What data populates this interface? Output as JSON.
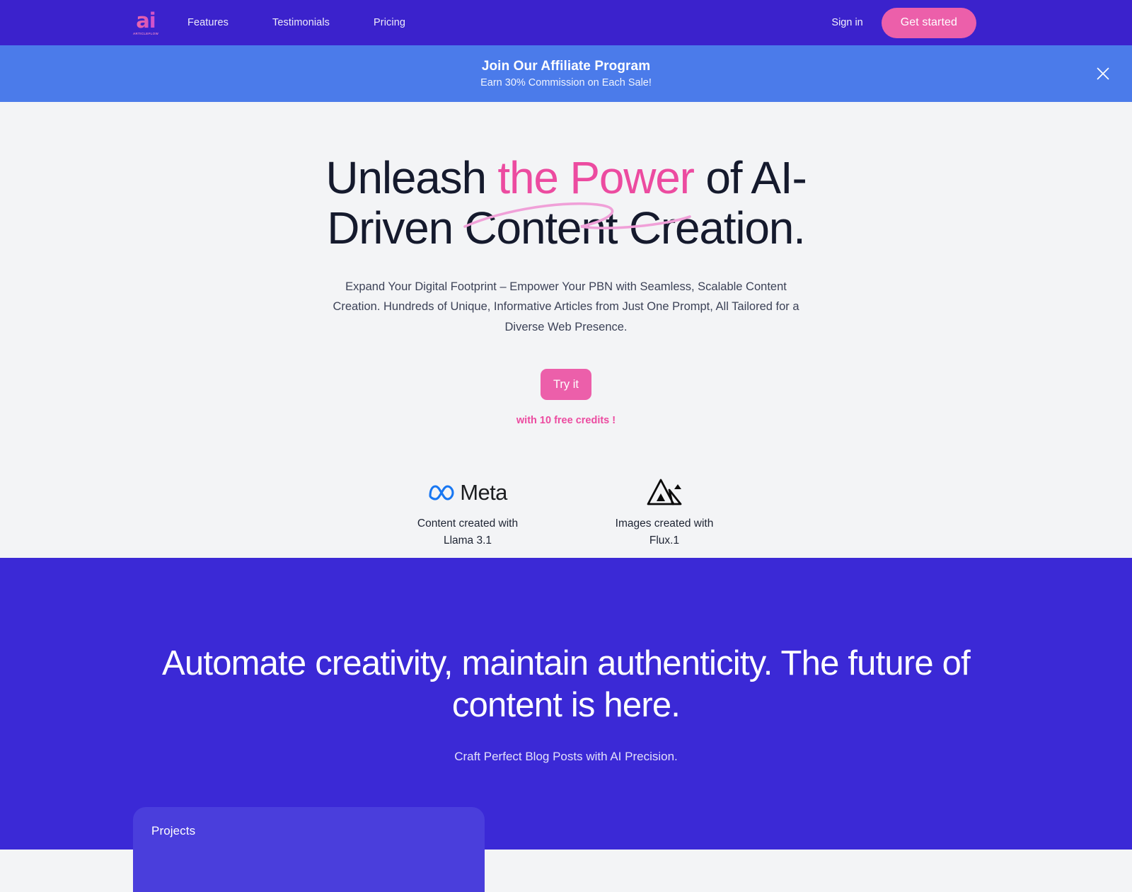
{
  "header": {
    "logo": {
      "mark": "ai",
      "subtext": "ARTICLEFLOW"
    },
    "nav_items": [
      {
        "label": "Features"
      },
      {
        "label": "Testimonials"
      },
      {
        "label": "Pricing"
      }
    ],
    "signin_label": "Sign in",
    "get_started_label": "Get started"
  },
  "banner": {
    "title": "Join Our Affiliate Program",
    "subtitle": "Earn 30% Commission on Each Sale!",
    "close_icon": "close-icon"
  },
  "hero": {
    "heading_part1": "Unleash ",
    "heading_highlight": "the Power",
    "heading_part2": " of AI-Driven Content Creation.",
    "subtitle": "Expand Your Digital Footprint – Empower Your PBN with Seamless, Scalable Content Creation. Hundreds of Unique, Informative Articles from Just One Prompt, All Tailored for a Diverse Web Presence.",
    "cta_label": "Try it",
    "credits_note": "with 10 free credits !",
    "partners": [
      {
        "logo_icon": "meta-infinity-icon",
        "name": "Meta",
        "caption": "Content created with Llama 3.1"
      },
      {
        "logo_icon": "flux-triangle-icon",
        "name": "",
        "caption": "Images created with Flux.1"
      }
    ]
  },
  "promo": {
    "heading": "Automate creativity, maintain authenticity. The future of content is here.",
    "subtitle": "Craft Perfect Blog Posts with AI Precision.",
    "card_title": "Projects"
  },
  "colors": {
    "header_indigo": "#3B22CC",
    "banner_blue": "#4B7BEA",
    "accent_pink": "#EC5FAA",
    "heading_pink": "#EC4BA0",
    "squiggle_pink": "#F0A0D8",
    "hero_bg": "#F3F4F6",
    "promo_indigo": "#3B29D6",
    "card_indigo": "#4A3EDC",
    "dark_text": "#151A2D"
  }
}
